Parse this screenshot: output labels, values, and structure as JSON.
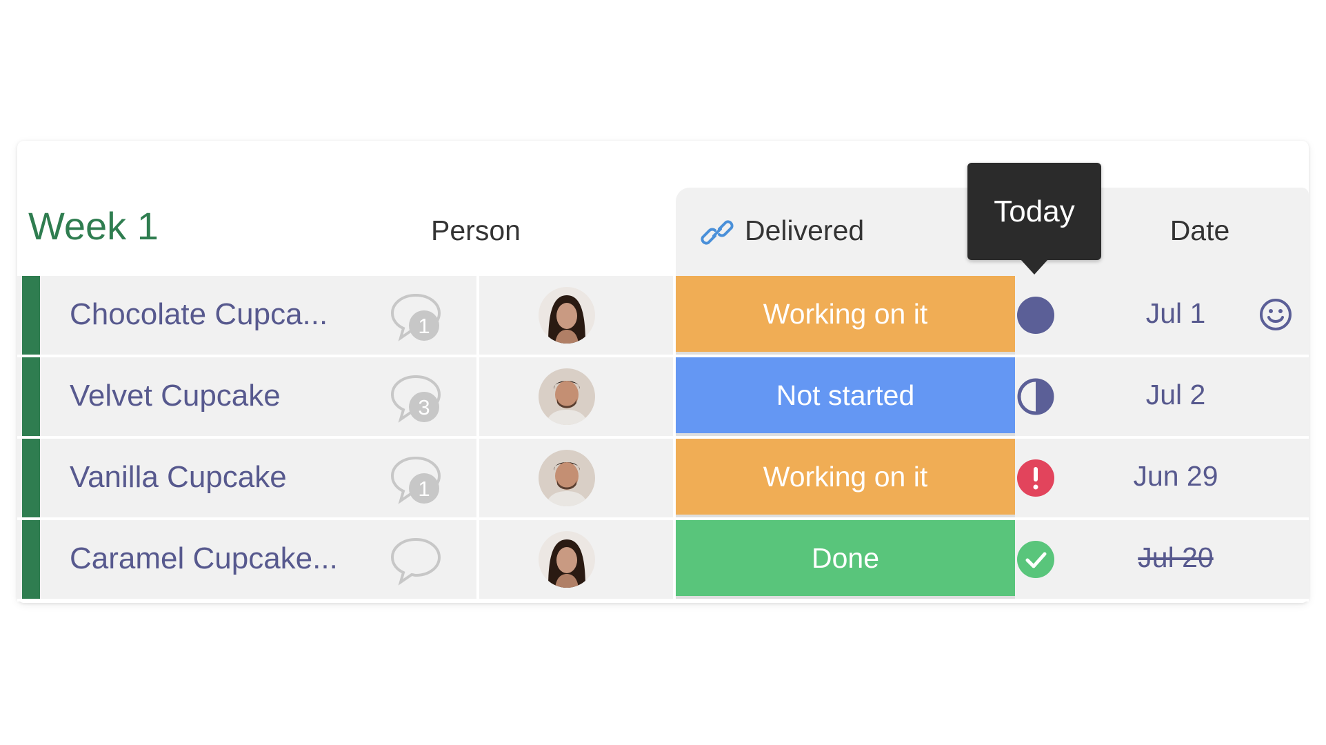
{
  "group": {
    "title": "Week 1",
    "color": "#2f7d50"
  },
  "columns": {
    "person": "Person",
    "delivered": "Delivered",
    "date": "Date"
  },
  "tooltip": {
    "text": "Today"
  },
  "status_colors": {
    "Working on it": "#f0ad55",
    "Not started": "#6497f3",
    "Done": "#59c57b"
  },
  "rows": [
    {
      "name": "Chocolate Cupca...",
      "comments": "1",
      "person": "woman",
      "status": "Working on it",
      "indicator": "full-circle",
      "date": "Jul 1",
      "strikethrough": false
    },
    {
      "name": "Velvet Cupcake",
      "comments": "3",
      "person": "man",
      "status": "Not started",
      "indicator": "half-circle",
      "date": "Jul 2",
      "strikethrough": false
    },
    {
      "name": "Vanilla Cupcake",
      "comments": "1",
      "person": "man",
      "status": "Working on it",
      "indicator": "alert",
      "date": "Jun 29",
      "strikethrough": false
    },
    {
      "name": "Caramel Cupcake...",
      "comments": "",
      "person": "woman",
      "status": "Done",
      "indicator": "check",
      "date": "Jul 20",
      "strikethrough": true
    }
  ]
}
